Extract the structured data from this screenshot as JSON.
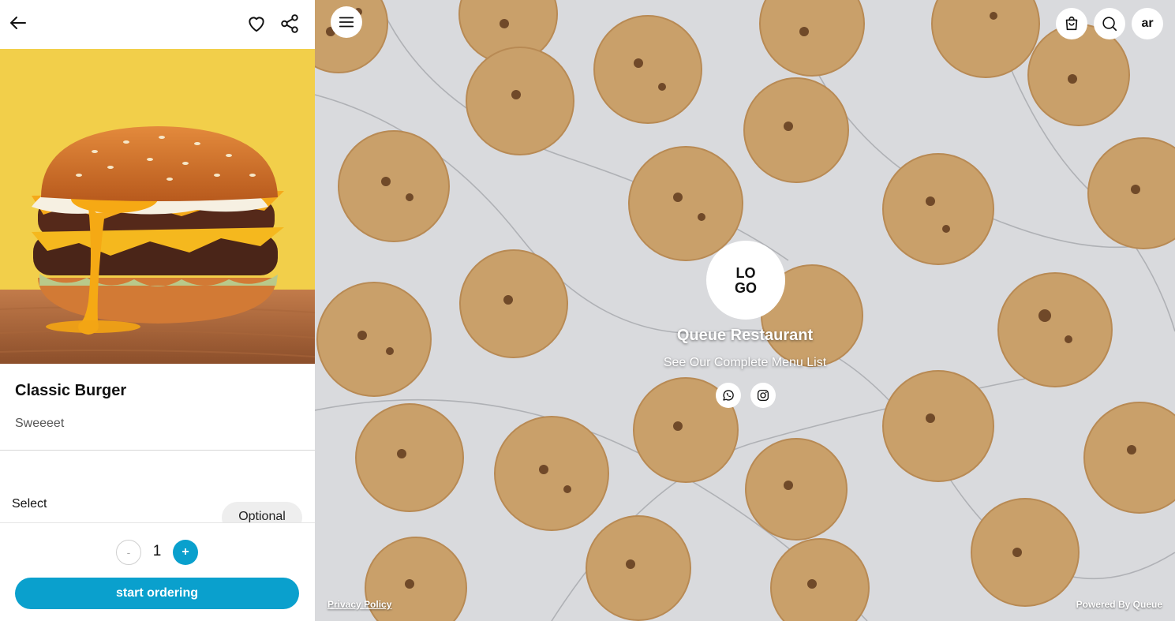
{
  "product": {
    "name": "Classic Burger",
    "description": "Sweeeet",
    "select_label": "Select",
    "optional_label": "Optional",
    "quantity": "1",
    "minus_label": "-",
    "plus_label": "+",
    "start_ordering_label": "start ordering"
  },
  "header": {
    "language_label": "ar"
  },
  "restaurant": {
    "name": "Queue Restaurant",
    "tagline": "See Our Complete Menu List",
    "logo_text_top": "LO",
    "logo_text_bottom": "GO"
  },
  "footer": {
    "privacy_label": "Privacy Policy",
    "powered_by_label": "Powered By Queue"
  },
  "icons": {
    "back": "arrow-left-icon",
    "favorite": "heart-icon",
    "share": "share-icon",
    "menu": "hamburger-icon",
    "cart": "shopping-bag-icon",
    "search": "search-icon",
    "whatsapp": "whatsapp-icon",
    "instagram": "instagram-icon"
  },
  "colors": {
    "accent": "#0aa0cd",
    "product_bg": "#f2cf4a",
    "marble": "#d9dadd",
    "cookie": "#c9a06a"
  }
}
